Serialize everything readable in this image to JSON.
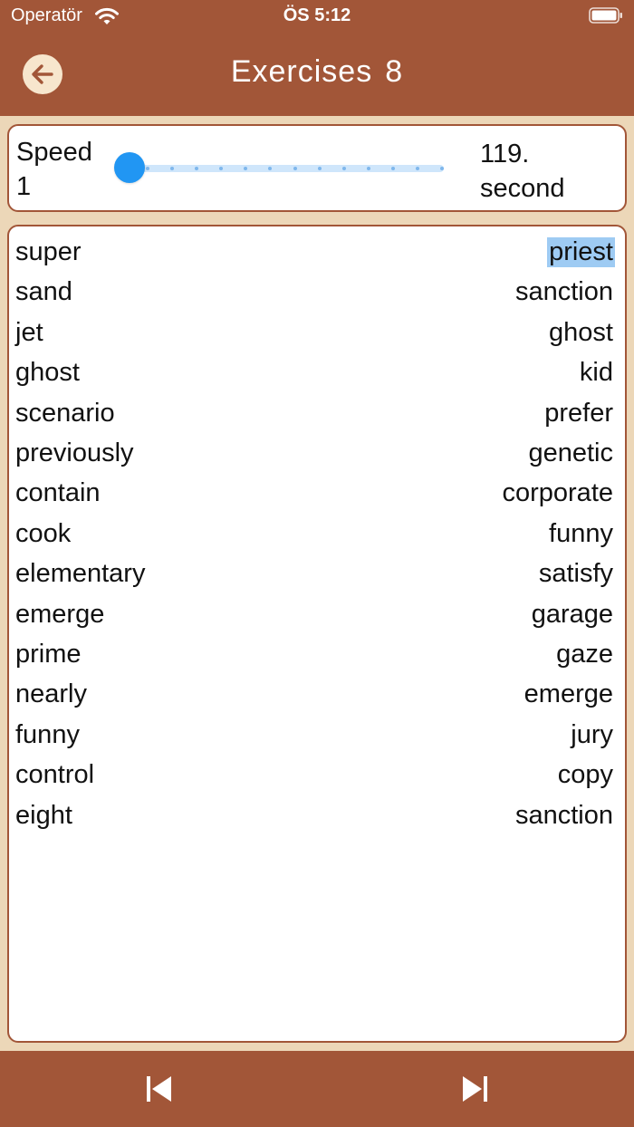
{
  "status_bar": {
    "carrier": "Operatör",
    "time": "ÖS 5:12"
  },
  "header": {
    "title": "Exercises",
    "number": "8",
    "background_color": "#a25638"
  },
  "speed": {
    "label": "Speed 1",
    "slider_value": 0,
    "value_text": "119. second",
    "accent_color": "#2196f3"
  },
  "words": {
    "rows": [
      {
        "left": "super",
        "right": "priest",
        "selected": true
      },
      {
        "left": "sand",
        "right": "sanction"
      },
      {
        "left": "jet",
        "right": "ghost"
      },
      {
        "left": "ghost",
        "right": "kid"
      },
      {
        "left": "scenario",
        "right": "prefer"
      },
      {
        "left": "previously",
        "right": "genetic"
      },
      {
        "left": "contain",
        "right": "corporate"
      },
      {
        "left": "cook",
        "right": "funny"
      },
      {
        "left": "elementary",
        "right": "satisfy"
      },
      {
        "left": "emerge",
        "right": "garage"
      },
      {
        "left": "prime",
        "right": "gaze"
      },
      {
        "left": "nearly",
        "right": "emerge"
      },
      {
        "left": "funny",
        "right": "jury"
      },
      {
        "left": "control",
        "right": "copy"
      },
      {
        "left": "eight",
        "right": "sanction"
      }
    ]
  },
  "bottom_nav": {
    "prev_icon": "skip-previous-icon",
    "next_icon": "skip-next-icon"
  }
}
